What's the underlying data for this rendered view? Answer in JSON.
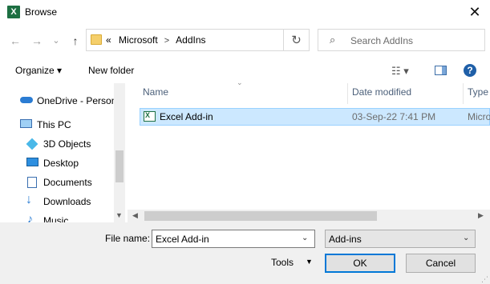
{
  "window": {
    "title": "Browse",
    "close_glyph": "✕",
    "app_icon_letter": "X"
  },
  "nav": {
    "back_glyph": "←",
    "forward_glyph": "→",
    "dropdown_glyph": "⌄",
    "up_glyph": "↑",
    "breadcrumb_prefix": "«",
    "breadcrumb": [
      "Microsoft",
      "AddIns"
    ],
    "refresh_glyph": "↻",
    "search_placeholder": "Search AddIns"
  },
  "toolbar": {
    "organize_label": "Organize ▾",
    "new_folder_label": "New folder",
    "help_glyph": "?"
  },
  "sidebar": {
    "items": [
      {
        "label": "OneDrive - Person",
        "icon": "cloud-icon"
      },
      {
        "label": "This PC",
        "icon": "monitor-icon"
      },
      {
        "label": "3D Objects",
        "icon": "cube-icon"
      },
      {
        "label": "Desktop",
        "icon": "desktop-icon"
      },
      {
        "label": "Documents",
        "icon": "document-icon"
      },
      {
        "label": "Downloads",
        "icon": "download-icon"
      },
      {
        "label": "Music",
        "icon": "music-icon"
      }
    ]
  },
  "filelist": {
    "columns": [
      "Name",
      "Date modified",
      "Type"
    ],
    "rows": [
      {
        "name": "Excel Add-in",
        "date": "03-Sep-22 7:41 PM",
        "type": "Micro",
        "selected": true
      }
    ]
  },
  "footer": {
    "file_name_label": "File name:",
    "file_name_value": "Excel Add-in",
    "file_type_value": "Add-ins",
    "tools_label": "Tools",
    "ok_label": "OK",
    "cancel_label": "Cancel"
  },
  "colors": {
    "accent": "#0078d7",
    "selection": "#cce8ff",
    "excel_green": "#1d6f42",
    "footer_bg": "#f0f0f0"
  }
}
